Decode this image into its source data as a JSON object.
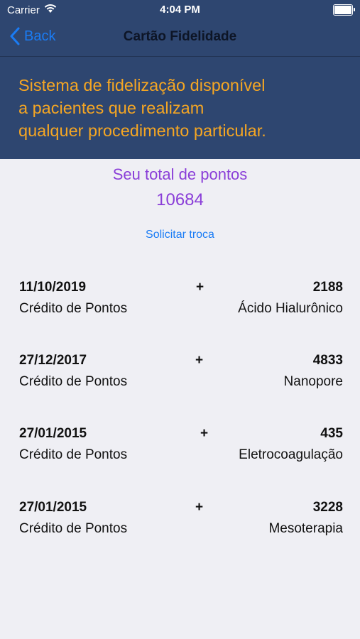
{
  "status_bar": {
    "carrier": "Carrier",
    "time": "4:04 PM",
    "battery_level": 1.0
  },
  "nav": {
    "back_label": "Back",
    "title": "Cartão Fidelidade"
  },
  "banner": {
    "line1": "Sistema de fidelização disponível",
    "line2": "a pacientes que realizam",
    "line3": "qualquer procedimento particular."
  },
  "points": {
    "label": "Seu total de pontos",
    "value": "10684",
    "exchange_label": "Solicitar troca"
  },
  "transactions": [
    {
      "date": "11/10/2019",
      "sign": "+",
      "points": "2188",
      "type": "Crédito de Pontos",
      "procedure": "Ácido Hialurônico"
    },
    {
      "date": "27/12/2017",
      "sign": "+",
      "points": "4833",
      "type": "Crédito de Pontos",
      "procedure": "Nanopore"
    },
    {
      "date": "27/01/2015",
      "sign": "+",
      "points": "435",
      "type": "Crédito de Pontos",
      "procedure": "Eletrocoagulação"
    },
    {
      "date": "27/01/2015",
      "sign": "+",
      "points": "3228",
      "type": "Crédito de Pontos",
      "procedure": "Mesoterapia"
    }
  ],
  "colors": {
    "header_background": "#2e4670",
    "banner_text": "#f5a623",
    "points_text": "#8a3ed8",
    "link": "#1a7cf5",
    "page_background": "#efeff4"
  }
}
